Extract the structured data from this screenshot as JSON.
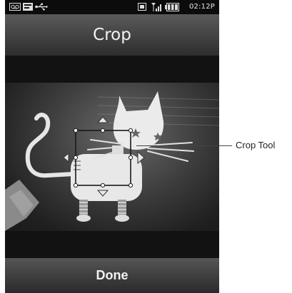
{
  "status_bar": {
    "icons": [
      "voicemail-icon",
      "message-icon",
      "usb-icon",
      "3g-icon",
      "signal-icon",
      "battery-icon"
    ],
    "time": "02:12P"
  },
  "header": {
    "title": "Crop"
  },
  "photo": {
    "subject": "cat-figurine-photo"
  },
  "footer": {
    "done_label": "Done"
  },
  "callout": {
    "label": "Crop Tool"
  },
  "colors": {
    "bar": "#3a3a3a",
    "background": "#141414",
    "text": "#f2f2f2"
  }
}
